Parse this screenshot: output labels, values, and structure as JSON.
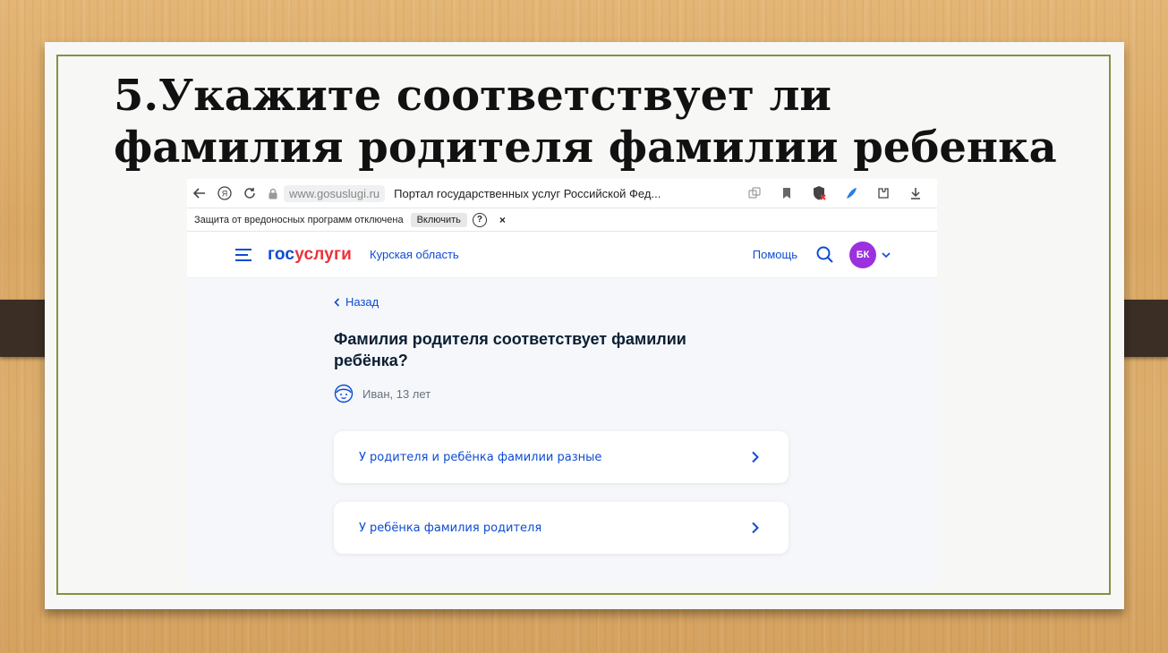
{
  "slide": {
    "title_line1": "5.Укажите соответствует ли",
    "title_line2": "фамилия родителя фамилии ребенка"
  },
  "browser": {
    "domain": "www.gosuslugi.ru",
    "page_title": "Портал государственных услуг Российской Фед...",
    "infobar_text": "Защита от вредоносных программ отключена",
    "infobar_button": "Включить",
    "infobar_help": "?",
    "infobar_close": "×"
  },
  "header": {
    "logo_part1": "гос",
    "logo_part2": "услуги",
    "region": "Курская область",
    "help": "Помощь",
    "avatar_initials": "БК"
  },
  "form": {
    "back_label": "Назад",
    "question": "Фамилия родителя соответствует фамилии ребёнка?",
    "child_label": "Иван, 13 лет",
    "options": [
      {
        "label": "У родителя и ребёнка фамилии разные"
      },
      {
        "label": "У ребёнка фамилия родителя"
      }
    ]
  },
  "colors": {
    "accent": "#0d4cd3",
    "logo_red": "#e8353b",
    "avatar": "#9c30de",
    "frame_green": "#7f9440"
  }
}
